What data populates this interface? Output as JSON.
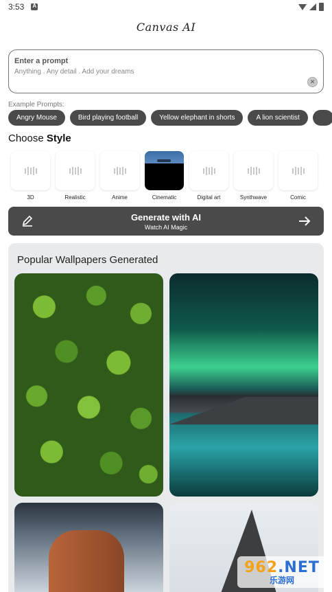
{
  "status": {
    "time": "3:53"
  },
  "app": {
    "title": "Canvas AI"
  },
  "prompt": {
    "label": "Enter a prompt",
    "placeholder": "Anything . Any detail . Add your dreams",
    "clear_icon": "close-circle-icon"
  },
  "examples": {
    "label": "Example Prompts:",
    "chips": [
      "Angry Mouse",
      "Bird playing football",
      "Yellow elephant in shorts",
      "A lion scientist",
      ""
    ]
  },
  "style_section": {
    "prefix": "Choose ",
    "bold": "Style"
  },
  "styles": [
    {
      "label": "3D"
    },
    {
      "label": "Realistic"
    },
    {
      "label": "Anime"
    },
    {
      "label": "Cinematic"
    },
    {
      "label": "Digital art"
    },
    {
      "label": "Synthwave"
    },
    {
      "label": "Comic"
    }
  ],
  "selected_style": "Cinematic",
  "generate": {
    "title": "Generate with AI",
    "subtitle": "Watch AI Magic"
  },
  "wallpapers": {
    "title": "Popular Wallpapers Generated"
  },
  "watermark": {
    "top_a": "962",
    "top_b": ".NET",
    "bottom": "乐游网"
  },
  "colors": {
    "button_bg": "#4a4a4a",
    "panel_bg": "#e8eaeb",
    "accent_orange": "#f4a21a",
    "accent_blue": "#2a6fd1"
  }
}
